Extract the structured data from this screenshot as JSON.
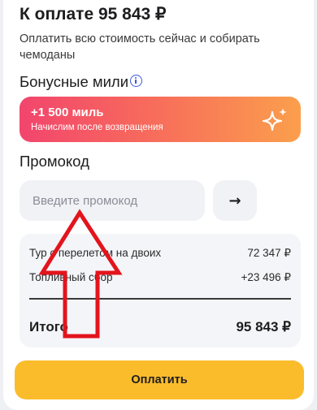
{
  "payment": {
    "title": "К оплате 95 843 ₽",
    "subtitle": "Оплатить всю стоимость сейчас и собирать чемоданы"
  },
  "bonus": {
    "title": "Бонусные мили",
    "info_icon": "info-icon",
    "amount": "+1 500 миль",
    "note": "Начислим после возвращения",
    "icon": "sparkle-icon",
    "gradient_colors": [
      "#f2456d",
      "#fb9f4c"
    ]
  },
  "promo": {
    "title": "Промокод",
    "placeholder": "Введите промокод",
    "value": "",
    "submit_icon": "→"
  },
  "summary": {
    "rows": [
      {
        "label": "Тур с перелетом на двоих",
        "value": "72 347 ₽"
      },
      {
        "label": "Топливный сбор",
        "value": "+23 496 ₽"
      }
    ],
    "total_label": "Итого",
    "total_value": "95 843 ₽"
  },
  "pay_button": {
    "label": "Оплатить",
    "color": "#fbbc2c"
  },
  "annotation": {
    "color": "#e3141c",
    "icon": "arrow-up-annotation"
  }
}
